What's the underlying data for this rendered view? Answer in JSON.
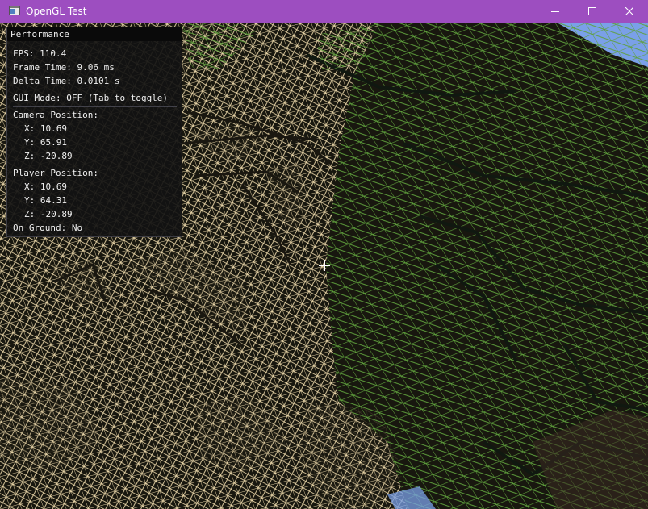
{
  "window": {
    "title": "OpenGL Test",
    "title_bar_color": "#9d4ec0",
    "controls": [
      "minimize-icon",
      "maximize-icon",
      "close-icon"
    ]
  },
  "panel": {
    "title": "Performance",
    "fps": "FPS: 110.4",
    "frame_time": "Frame Time: 9.06 ms",
    "delta_time": "Delta Time: 0.0101 s",
    "gui_mode": "GUI Mode: OFF (Tab to toggle)",
    "camera_heading": "Camera Position:",
    "camera_x": "X: 10.69",
    "camera_y": "Y: 65.91",
    "camera_z": "Z: -20.89",
    "player_heading": "Player Position:",
    "player_x": "X: 10.69",
    "player_y": "Y: 64.31",
    "player_z": "Z: -20.89",
    "on_ground": "On Ground: No"
  },
  "scene": {
    "sand_wire_color": "#ead6a8",
    "grass_wire_color": "#5d9a3c",
    "sky_color": "#7aa0e8",
    "crosshair_color": "#ffffff"
  }
}
